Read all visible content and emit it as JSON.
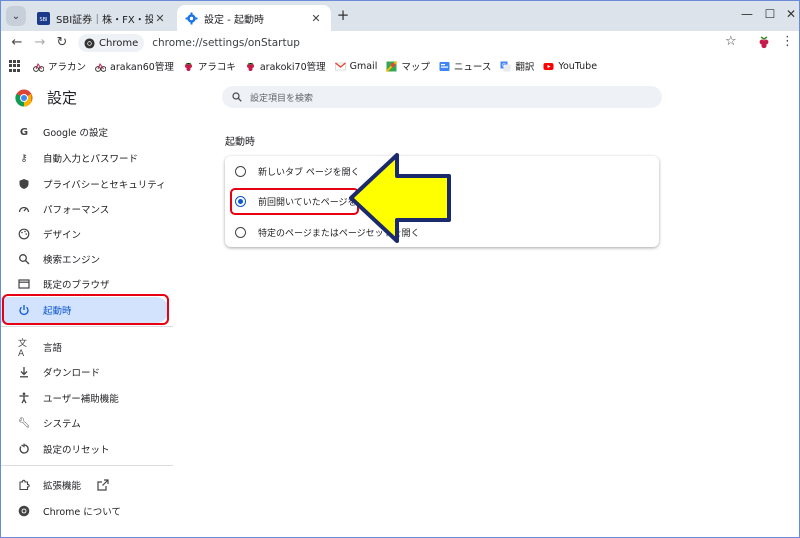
{
  "tabs": [
    {
      "title": "SBI証券｜株・FX・投資信託・",
      "active": false,
      "favicon": "sbi-favicon"
    },
    {
      "title": "設定 - 起動時",
      "active": true,
      "favicon": "gear-icon"
    }
  ],
  "toolbar": {
    "chip_label": "Chrome",
    "url": "chrome://settings/onStartup"
  },
  "bookmarks": [
    {
      "label": "アラカン",
      "icon": "raspberry-icon"
    },
    {
      "label": "arakan60管理",
      "icon": "raspberry-icon"
    },
    {
      "label": "アラコキ",
      "icon": "raspberry-icon"
    },
    {
      "label": "arakoki70管理",
      "icon": "raspberry-icon"
    },
    {
      "label": "Gmail",
      "icon": "gmail-icon"
    },
    {
      "label": "マップ",
      "icon": "maps-icon"
    },
    {
      "label": "ニュース",
      "icon": "news-icon"
    },
    {
      "label": "翻訳",
      "icon": "translate-icon"
    },
    {
      "label": "YouTube",
      "icon": "youtube-icon"
    }
  ],
  "settings": {
    "heading": "設定",
    "search_placeholder": "設定項目を検索"
  },
  "sidebar": {
    "items": [
      {
        "label": "Google の設定",
        "icon": "google-g-icon",
        "selected": false
      },
      {
        "label": "自動入力とパスワード",
        "icon": "key-icon",
        "selected": false
      },
      {
        "label": "プライバシーとセキュリティ",
        "icon": "shield-icon",
        "selected": false
      },
      {
        "label": "パフォーマンス",
        "icon": "speedometer-icon",
        "selected": false
      },
      {
        "label": "デザイン",
        "icon": "palette-icon",
        "selected": false
      },
      {
        "label": "検索エンジン",
        "icon": "search-icon",
        "selected": false
      },
      {
        "label": "既定のブラウザ",
        "icon": "browser-window-icon",
        "selected": false
      },
      {
        "label": "起動時",
        "icon": "power-icon",
        "selected": true
      },
      {
        "label": "言語",
        "icon": "translate-icon",
        "selected": false
      },
      {
        "label": "ダウンロード",
        "icon": "download-icon",
        "selected": false
      },
      {
        "label": "ユーザー補助機能",
        "icon": "accessibility-icon",
        "selected": false
      },
      {
        "label": "システム",
        "icon": "wrench-icon",
        "selected": false
      },
      {
        "label": "設定のリセット",
        "icon": "reset-icon",
        "selected": false
      },
      {
        "label": "拡張機能",
        "icon": "puzzle-icon",
        "selected": false
      },
      {
        "label": "Chrome について",
        "icon": "chrome-logo-icon",
        "selected": false
      }
    ]
  },
  "startup": {
    "section_title": "起動時",
    "options": [
      {
        "label": "新しいタブ ページを開く",
        "checked": false
      },
      {
        "label": "前回開いていたページを開く",
        "checked": true
      },
      {
        "label": "特定のページまたはページセットを開く",
        "checked": false
      }
    ]
  },
  "colors": {
    "accent": "#0b57d0",
    "highlight_border": "#e60012",
    "arrow_fill": "#ffff00",
    "arrow_stroke": "#1a2a6c"
  }
}
